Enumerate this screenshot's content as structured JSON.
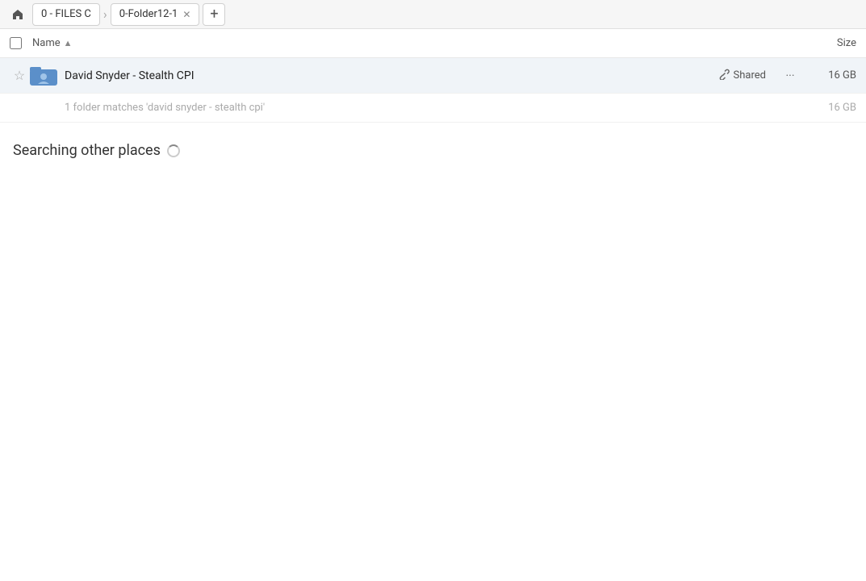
{
  "breadcrumb": {
    "home_icon": "🏠",
    "tabs": [
      {
        "label": "0 - FILES C",
        "closable": false
      },
      {
        "label": "0-Folder12-1",
        "closable": true
      }
    ],
    "add_icon": "+"
  },
  "column_header": {
    "name_label": "Name",
    "sort_arrow": "▲",
    "size_label": "Size"
  },
  "file_row": {
    "star_icon": "☆",
    "name": "David Snyder - Stealth CPI",
    "shared_label": "Shared",
    "link_icon": "🔗",
    "more_icon": "•••",
    "size": "16 GB"
  },
  "match_info": {
    "text": "1 folder matches 'david snyder - stealth cpi'",
    "size": "16 GB"
  },
  "searching_section": {
    "title": "Searching other places"
  }
}
